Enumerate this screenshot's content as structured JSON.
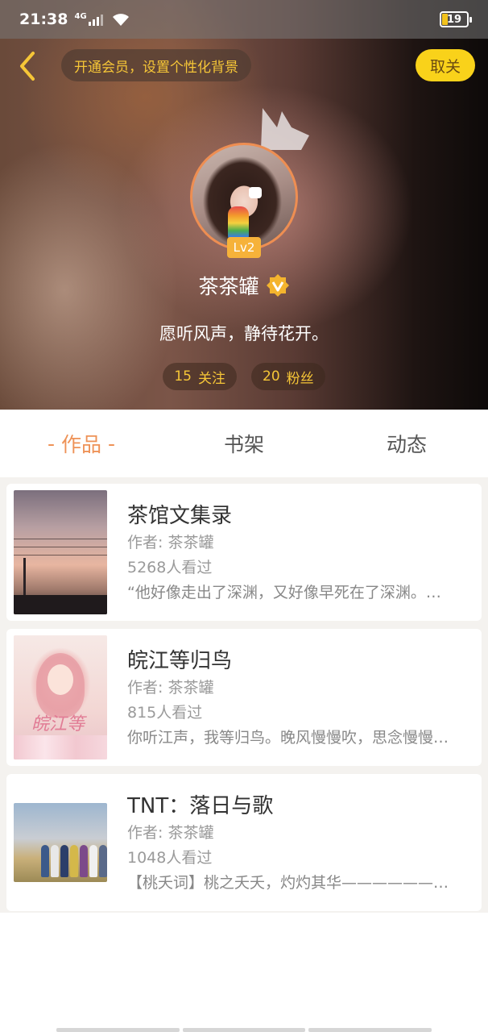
{
  "status_bar": {
    "time": "21:38",
    "network": "4G",
    "battery": "19",
    "battery_color": "#f2c21c"
  },
  "header": {
    "back_icon": "chevron-left-icon",
    "vip_prompt": "开通会员，设置个性化背景",
    "follow_label": "取关"
  },
  "profile": {
    "crown_icon": "crown-icon",
    "level": "Lv2",
    "name": "茶茶罐",
    "verify_icon": "verified-v-icon",
    "signature": "愿听风声，静待花开。",
    "following_count": "15",
    "following_label": "关注",
    "followers_count": "20",
    "followers_label": "粉丝"
  },
  "tabs": [
    {
      "label": "作品",
      "active": true
    },
    {
      "label": "书架",
      "active": false
    },
    {
      "label": "动态",
      "active": false
    }
  ],
  "works": [
    {
      "title": "茶馆文集录",
      "author": "作者: 茶茶罐",
      "views": "5268人看过",
      "desc": "“他好像走出了深渊，又好像早死在了深渊。…"
    },
    {
      "title": "皖江等归鸟",
      "author": "作者: 茶茶罐",
      "views": "815人看过",
      "desc": "你听江声，我等归鸟。晚风慢慢吹，思念慢慢…",
      "cover_text": "皖江等归鸟"
    },
    {
      "title": "TNT：落日与歌",
      "author": "作者: 茶茶罐",
      "views": "1048人看过",
      "desc": "【桃夭词】桃之夭夭，灼灼其华——————…"
    }
  ],
  "colors": {
    "accent_orange": "#ee9257",
    "vip_gold": "#f6c637",
    "follow_yellow": "#f9d21a"
  }
}
